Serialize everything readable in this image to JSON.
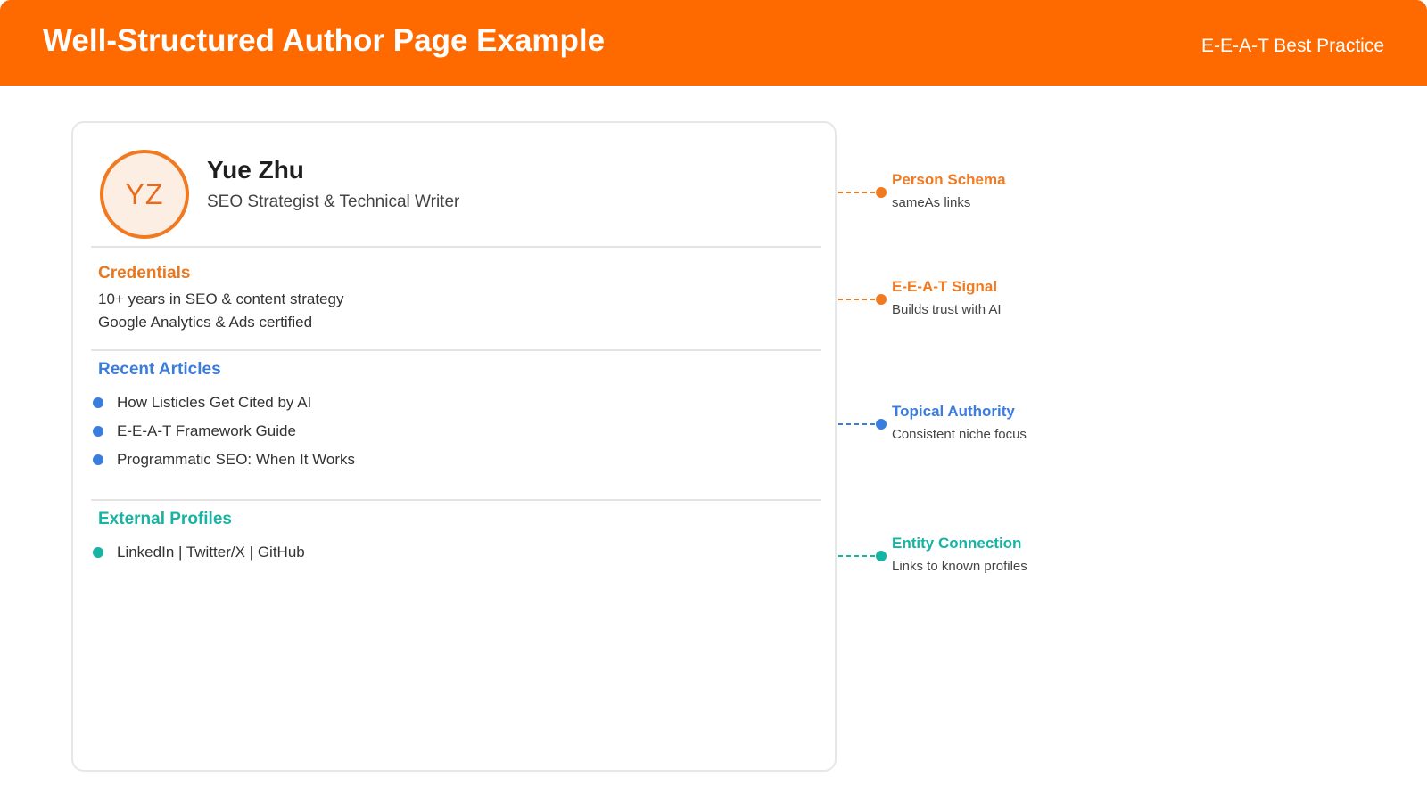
{
  "header": {
    "title": "Well-Structured Author Page Example",
    "badge": "E-E-A-T Best Practice"
  },
  "author": {
    "initials": "YZ",
    "name": "Yue Zhu",
    "role": "SEO Strategist & Technical Writer"
  },
  "credentials": {
    "title": "Credentials",
    "items": [
      "10+ years in SEO & content strategy",
      "Google Analytics & Ads certified"
    ]
  },
  "recent_articles": {
    "title": "Recent Articles",
    "items": [
      "How Listicles Get Cited by AI",
      "E-E-A-T Framework Guide",
      "Programmatic SEO: When It Works"
    ]
  },
  "external_profiles": {
    "title": "External Profiles",
    "items": [
      "LinkedIn | Twitter/X | GitHub"
    ]
  },
  "annotations": [
    {
      "title": "Person Schema",
      "subtitle": "sameAs links",
      "color": "#f07a22"
    },
    {
      "title": "E-E-A-T Signal",
      "subtitle": "Builds trust with AI",
      "color": "#f07a22"
    },
    {
      "title": "Topical Authority",
      "subtitle": "Consistent niche focus",
      "color": "#3b7ddd"
    },
    {
      "title": "Entity Connection",
      "subtitle": "Links to known profiles",
      "color": "#17b3a3"
    }
  ],
  "colors": {
    "header_bg": "#ff6a00",
    "orange": "#f07a22",
    "blue": "#3b7ddd",
    "teal": "#17b3a3"
  }
}
